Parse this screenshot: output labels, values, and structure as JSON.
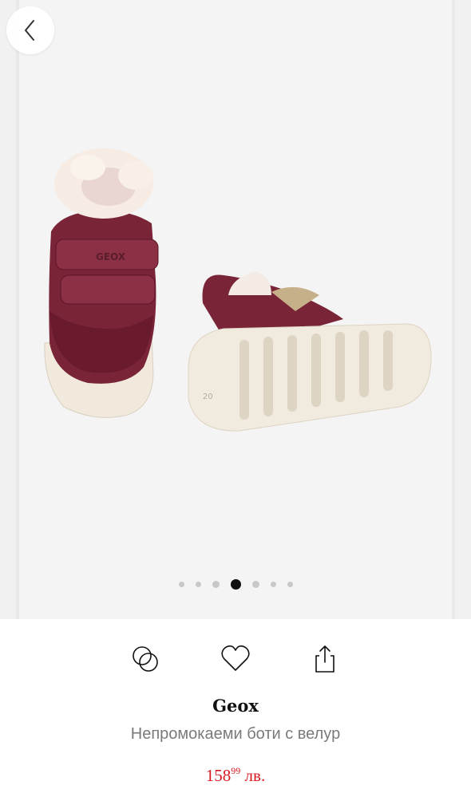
{
  "gallery": {
    "image_alt": "Geox winter baby boots",
    "dots": [
      {
        "size": "s",
        "active": false
      },
      {
        "size": "s",
        "active": false
      },
      {
        "size": "m",
        "active": false
      },
      {
        "size": "l",
        "active": true
      },
      {
        "size": "m",
        "active": false
      },
      {
        "size": "s",
        "active": false
      },
      {
        "size": "s",
        "active": false
      }
    ]
  },
  "nav": {
    "back_icon": "chevron-left-icon"
  },
  "actions": {
    "compare_icon": "compare-circles-icon",
    "favorite_icon": "heart-icon",
    "share_icon": "share-icon"
  },
  "product": {
    "brand": "Geox",
    "title": "Непромокаеми боти с велур",
    "price_main": "158",
    "price_cents": "99",
    "price_currency": "лв.",
    "shoe_logo": "GEOX",
    "sole_size": "20"
  },
  "colors": {
    "price": "#d71a21",
    "boot": "#7a2438",
    "sole": "#f1ebdf"
  }
}
